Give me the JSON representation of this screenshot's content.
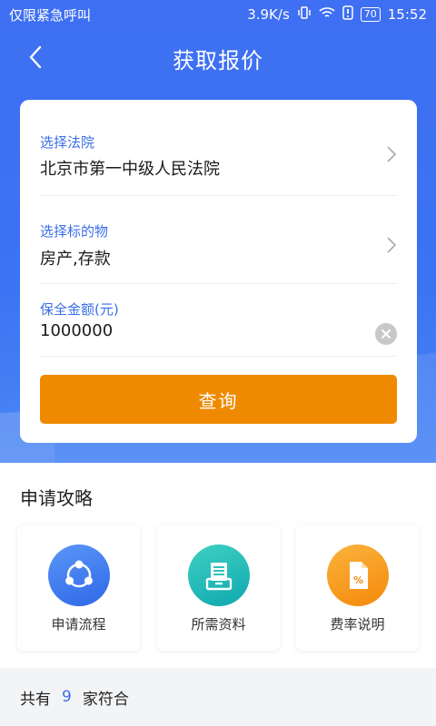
{
  "status_bar": {
    "carrier_text": "仅限紧急呼叫",
    "network_speed": "3.9K/s",
    "battery": "70",
    "time": "15:52"
  },
  "header": {
    "title": "获取报价"
  },
  "form": {
    "court": {
      "label": "选择法院",
      "value": "北京市第一中级人民法院"
    },
    "subject": {
      "label": "选择标的物",
      "value": "房产,存款"
    },
    "amount": {
      "label": "保全金额(元)",
      "value": "1000000"
    },
    "query_button": "查询"
  },
  "guide": {
    "title": "申请攻略",
    "tiles": [
      {
        "label": "申请流程",
        "icon": "share-nodes-icon",
        "color": "#3f7cf3"
      },
      {
        "label": "所需资料",
        "icon": "file-tray-icon",
        "color": "#16b8b4"
      },
      {
        "label": "费率说明",
        "icon": "percent-document-icon",
        "color": "#f79a1c"
      }
    ]
  },
  "result": {
    "prefix": "共有",
    "count": "9",
    "suffix": "家符合"
  }
}
